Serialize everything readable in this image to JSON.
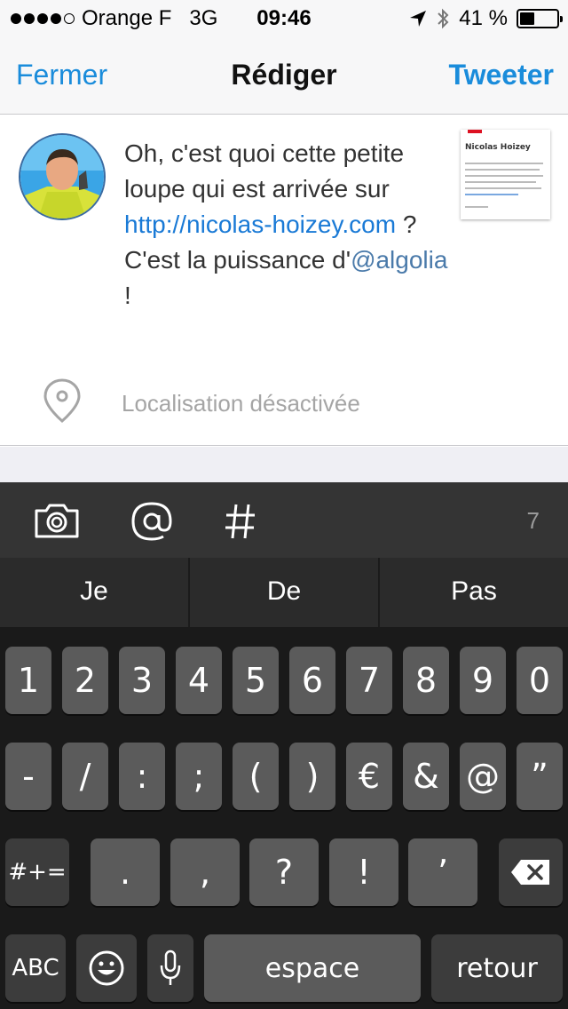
{
  "status": {
    "carrier": "Orange F",
    "network": "3G",
    "time": "09:46",
    "battery": "41 %",
    "battery_level": 0.41,
    "signal_bars": 4
  },
  "nav": {
    "close_label": "Fermer",
    "title": "Rédiger",
    "tweet_label": "Tweeter"
  },
  "tweet": {
    "text_1": "Oh, c'est quoi cette petite loupe qui est arrivée sur",
    "link": "http://nicolas-hoizey.com",
    "text_2": " ?",
    "text_3": "C'est la puissance d'",
    "mention": "@algolia",
    "text_4": " !"
  },
  "preview": {
    "name": "Nicolas Hoizey"
  },
  "location": {
    "label": "Localisation désactivée"
  },
  "toolbar": {
    "char_count": "7"
  },
  "suggestions": [
    "Je",
    "De",
    "Pas"
  ],
  "keyboard": {
    "row1": [
      "1",
      "2",
      "3",
      "4",
      "5",
      "6",
      "7",
      "8",
      "9",
      "0"
    ],
    "row2": [
      "-",
      "/",
      ":",
      ";",
      "(",
      ")",
      "€",
      "&",
      "@",
      "”"
    ],
    "row3_mode": "#+=",
    "row3": [
      ".",
      ",",
      "?",
      "!",
      "’"
    ],
    "abc": "ABC",
    "space": "espace",
    "return": "retour"
  },
  "colors": {
    "accent": "#1a8cdb",
    "keyboard_bg": "#1a1a1a",
    "key": "#5b5b5b"
  }
}
